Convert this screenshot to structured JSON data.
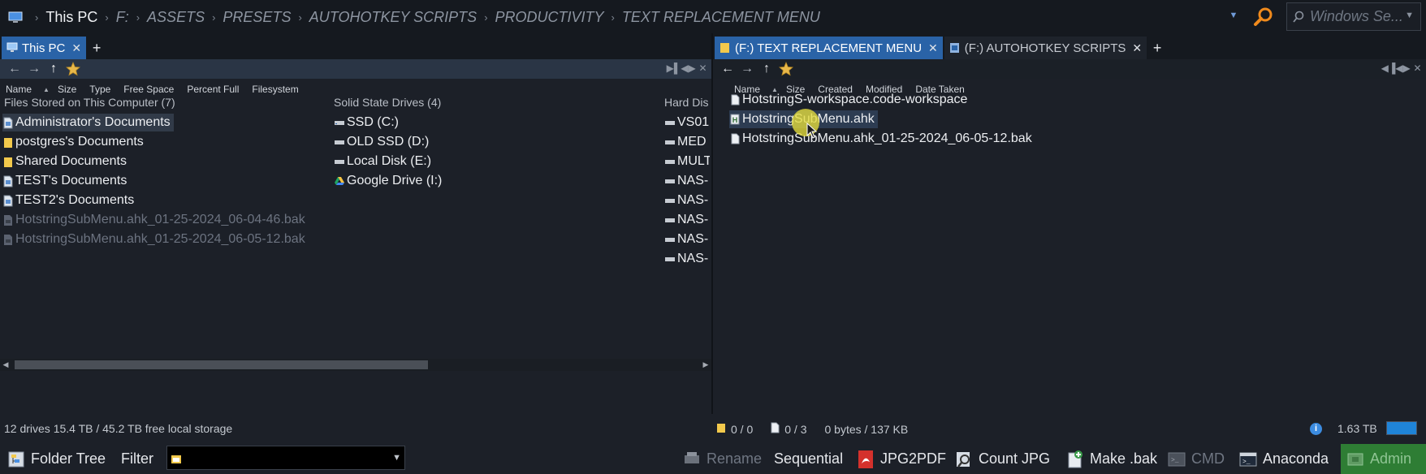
{
  "address": {
    "first": "This PC",
    "crumbs": [
      "F:",
      "ASSETS",
      "PRESETS",
      "AUTOHOTKEY SCRIPTS",
      "PRODUCTIVITY",
      "TEXT REPLACEMENT MENU"
    ],
    "search_placeholder": "Windows Se..."
  },
  "left_pane": {
    "tabs": [
      {
        "label": "This PC"
      }
    ],
    "columns": [
      "Name",
      "Size",
      "Type",
      "Free Space",
      "Percent Full",
      "Filesystem"
    ],
    "groups": {
      "computer": {
        "title": "Files Stored on This Computer (7)",
        "items": [
          "Administrator's Documents",
          "postgres's Documents",
          "Shared Documents",
          "TEST's Documents",
          "TEST2's Documents",
          "HotstringSubMenu.ahk_01-25-2024_06-04-46.bak",
          "HotstringSubMenu.ahk_01-25-2024_06-05-12.bak"
        ]
      },
      "ssd": {
        "title": "Solid State Drives (4)",
        "items": [
          "SSD (C:)",
          "OLD SSD (D:)",
          "Local Disk (E:)",
          "Google Drive (I:)"
        ]
      },
      "hdd": {
        "title": "Hard Dis",
        "items": [
          "VS01",
          "MED",
          "MULT",
          "NAS-",
          "NAS-",
          "NAS-",
          "NAS-",
          "NAS-"
        ]
      }
    }
  },
  "right_pane": {
    "tabs": [
      {
        "label": "(F:) TEXT REPLACEMENT MENU"
      },
      {
        "label": "(F:) AUTOHOTKEY SCRIPTS"
      }
    ],
    "columns": [
      "Name",
      "Size",
      "Created",
      "Modified",
      "Date Taken"
    ],
    "files": [
      "HotstringS-workspace.code-workspace",
      "HotstringSubMenu.ahk",
      "HotstringSubMenu.ahk_01-25-2024_06-05-12.bak"
    ]
  },
  "status": {
    "left": "12 drives  15.4 TB / 45.2 TB free local storage",
    "folders": "0 / 0",
    "files": "0 / 3",
    "bytes": "0 bytes / 137 KB",
    "space": "1.63 TB"
  },
  "bottom": {
    "folder_tree": "Folder Tree",
    "filter": "Filter",
    "rename": "Rename",
    "sequential": "Sequential",
    "jpg2pdf": "JPG2PDF",
    "count_jpg": "Count JPG",
    "make_bak": "Make .bak",
    "cmd": "CMD",
    "anaconda": "Anaconda",
    "admin": "Admin"
  },
  "colors": {
    "accent": "#2a63a7",
    "selection": "#313a48",
    "admin": "#2e7d34",
    "search_orange": "#f08a1c"
  }
}
